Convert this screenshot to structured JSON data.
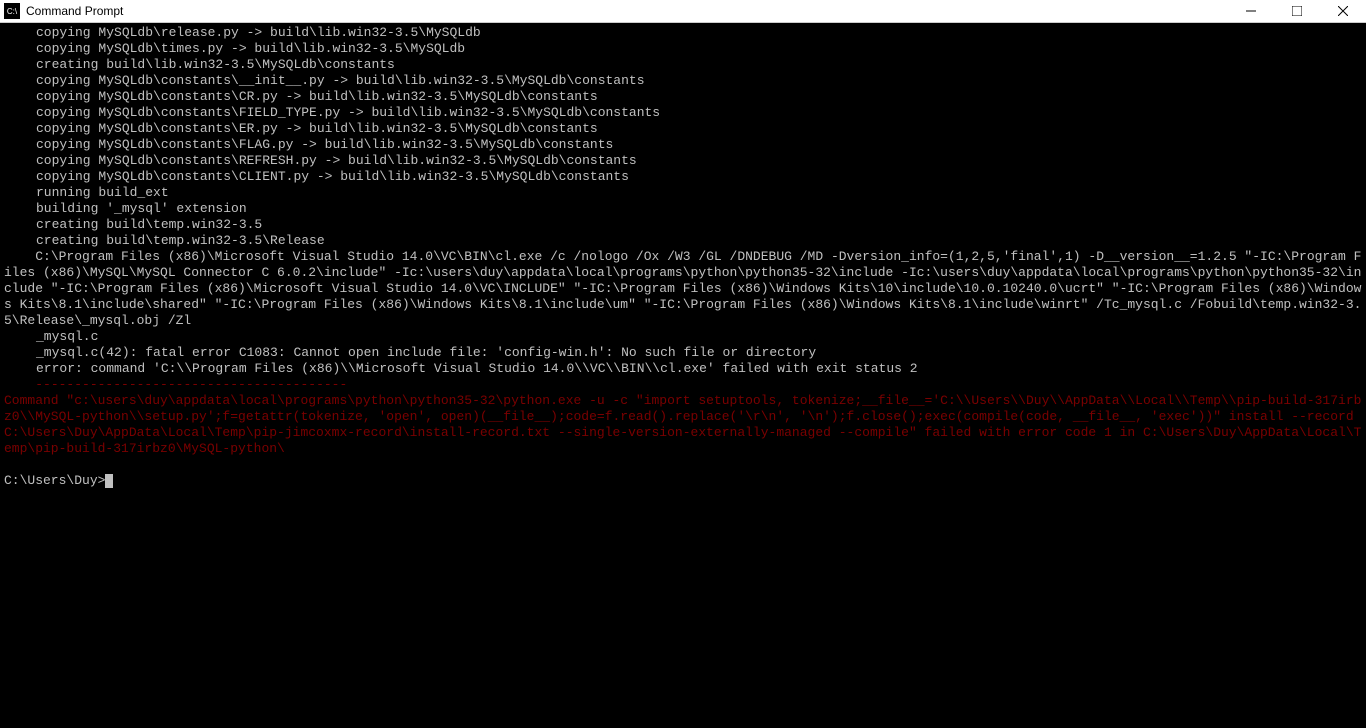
{
  "window": {
    "title": "Command Prompt",
    "icon_label": "C:\\"
  },
  "lines": [
    {
      "text": "copying MySQLdb\\release.py -> build\\lib.win32-3.5\\MySQLdb",
      "cls": "indent"
    },
    {
      "text": "copying MySQLdb\\times.py -> build\\lib.win32-3.5\\MySQLdb",
      "cls": "indent"
    },
    {
      "text": "creating build\\lib.win32-3.5\\MySQLdb\\constants",
      "cls": "indent"
    },
    {
      "text": "copying MySQLdb\\constants\\__init__.py -> build\\lib.win32-3.5\\MySQLdb\\constants",
      "cls": "indent"
    },
    {
      "text": "copying MySQLdb\\constants\\CR.py -> build\\lib.win32-3.5\\MySQLdb\\constants",
      "cls": "indent"
    },
    {
      "text": "copying MySQLdb\\constants\\FIELD_TYPE.py -> build\\lib.win32-3.5\\MySQLdb\\constants",
      "cls": "indent"
    },
    {
      "text": "copying MySQLdb\\constants\\ER.py -> build\\lib.win32-3.5\\MySQLdb\\constants",
      "cls": "indent"
    },
    {
      "text": "copying MySQLdb\\constants\\FLAG.py -> build\\lib.win32-3.5\\MySQLdb\\constants",
      "cls": "indent"
    },
    {
      "text": "copying MySQLdb\\constants\\REFRESH.py -> build\\lib.win32-3.5\\MySQLdb\\constants",
      "cls": "indent"
    },
    {
      "text": "copying MySQLdb\\constants\\CLIENT.py -> build\\lib.win32-3.5\\MySQLdb\\constants",
      "cls": "indent"
    },
    {
      "text": "running build_ext",
      "cls": "indent"
    },
    {
      "text": "building '_mysql' extension",
      "cls": "indent"
    },
    {
      "text": "creating build\\temp.win32-3.5",
      "cls": "indent"
    },
    {
      "text": "creating build\\temp.win32-3.5\\Release",
      "cls": "indent"
    },
    {
      "text": "    C:\\Program Files (x86)\\Microsoft Visual Studio 14.0\\VC\\BIN\\cl.exe /c /nologo /Ox /W3 /GL /DNDEBUG /MD -Dversion_info=(1,2,5,'final',1) -D__version__=1.2.5 \"-IC:\\Program Files (x86)\\MySQL\\MySQL Connector C 6.0.2\\include\" -Ic:\\users\\duy\\appdata\\local\\programs\\python\\python35-32\\include -Ic:\\users\\duy\\appdata\\local\\programs\\python\\python35-32\\include \"-IC:\\Program Files (x86)\\Microsoft Visual Studio 14.0\\VC\\INCLUDE\" \"-IC:\\Program Files (x86)\\Windows Kits\\10\\include\\10.0.10240.0\\ucrt\" \"-IC:\\Program Files (x86)\\Windows Kits\\8.1\\include\\shared\" \"-IC:\\Program Files (x86)\\Windows Kits\\8.1\\include\\um\" \"-IC:\\Program Files (x86)\\Windows Kits\\8.1\\include\\winrt\" /Tc_mysql.c /Fobuild\\temp.win32-3.5\\Release\\_mysql.obj /Zl",
      "cls": ""
    },
    {
      "text": "_mysql.c",
      "cls": "indent"
    },
    {
      "text": "_mysql.c(42): fatal error C1083: Cannot open include file: 'config-win.h': No such file or directory",
      "cls": "indent"
    },
    {
      "text": "error: command 'C:\\\\Program Files (x86)\\\\Microsoft Visual Studio 14.0\\\\VC\\\\BIN\\\\cl.exe' failed with exit status 2",
      "cls": "indent"
    },
    {
      "text": "",
      "cls": ""
    },
    {
      "text": "    ----------------------------------------",
      "cls": "error-red"
    },
    {
      "text": "Command \"c:\\users\\duy\\appdata\\local\\programs\\python\\python35-32\\python.exe -u -c \"import setuptools, tokenize;__file__='C:\\\\Users\\\\Duy\\\\AppData\\\\Local\\\\Temp\\\\pip-build-317irbz0\\\\MySQL-python\\\\setup.py';f=getattr(tokenize, 'open', open)(__file__);code=f.read().replace('\\r\\n', '\\n');f.close();exec(compile(code, __file__, 'exec'))\" install --record C:\\Users\\Duy\\AppData\\Local\\Temp\\pip-jimcoxmx-record\\install-record.txt --single-version-externally-managed --compile\" failed with error code 1 in C:\\Users\\Duy\\AppData\\Local\\Temp\\pip-build-317irbz0\\MySQL-python\\",
      "cls": "error-red"
    }
  ],
  "prompt": "C:\\Users\\Duy>"
}
